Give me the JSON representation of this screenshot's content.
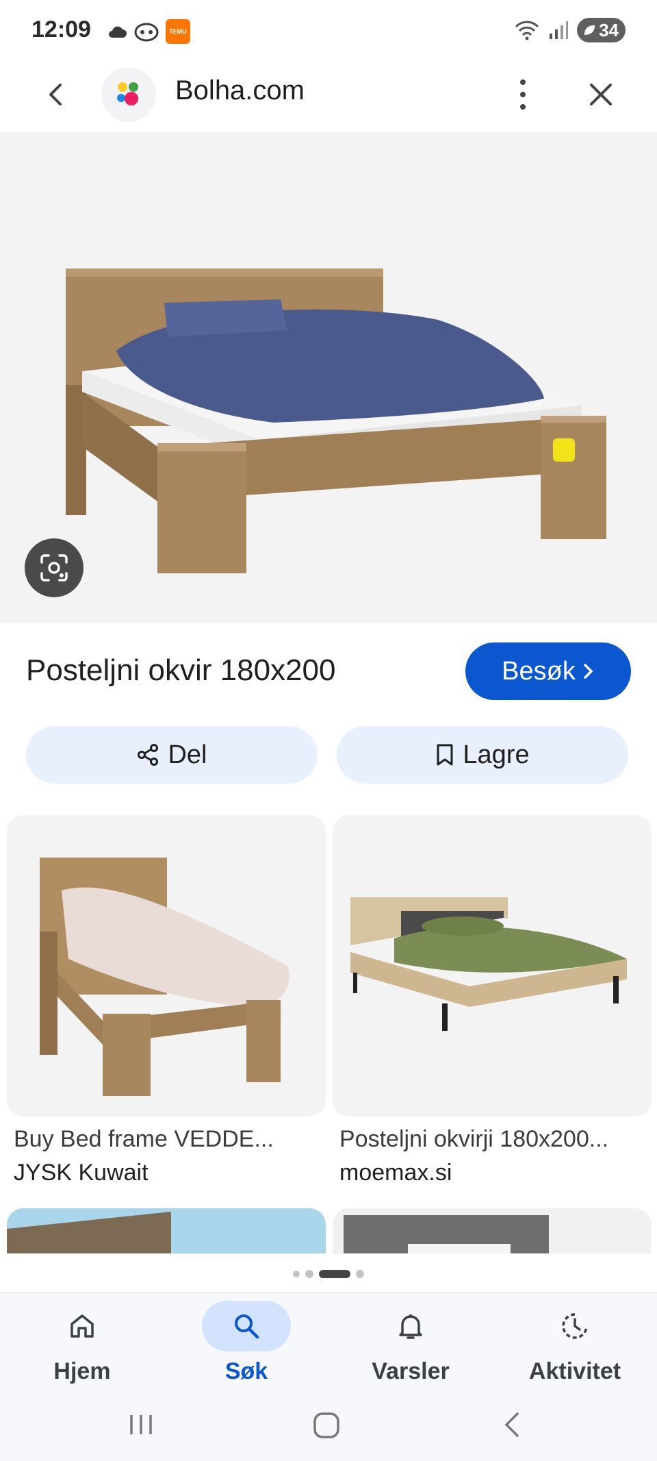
{
  "status_bar": {
    "time": "12:09",
    "temu_label": "TEMU",
    "battery": "34"
  },
  "header": {
    "site_name": "Bolha.com"
  },
  "product": {
    "title": "Posteljni okvir 180x200",
    "visit_label": "Besøk"
  },
  "actions": {
    "share_label": "Del",
    "save_label": "Lagre"
  },
  "results": [
    {
      "title": "Buy Bed frame VEDDE...",
      "source": "JYSK Kuwait"
    },
    {
      "title": "Posteljni okvirji 180x200...",
      "source": "moemax.si"
    }
  ],
  "bottom_nav": [
    {
      "label": "Hjem",
      "icon": "home-icon"
    },
    {
      "label": "Søk",
      "icon": "search-icon",
      "active": true
    },
    {
      "label": "Varsler",
      "icon": "bell-icon"
    },
    {
      "label": "Aktivitet",
      "icon": "activity-icon"
    }
  ],
  "colors": {
    "accent": "#0b57d0",
    "action_bg": "#e8f0fe",
    "active_nav_bg": "#d3e3fd"
  }
}
